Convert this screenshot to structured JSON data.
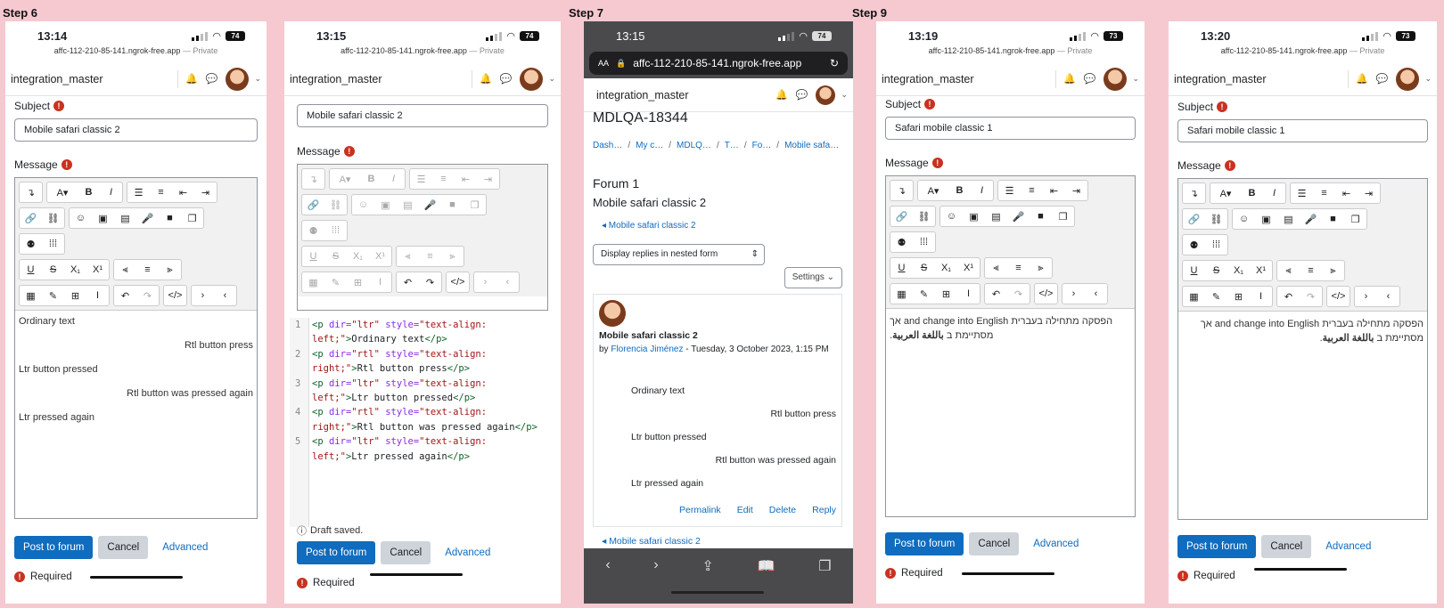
{
  "steps": [
    "Step 6",
    "Step 7",
    "Step 9"
  ],
  "status": {
    "times": [
      "13:14",
      "13:15",
      "13:15",
      "13:19",
      "13:20"
    ],
    "batteries": [
      "74",
      "74",
      "74",
      "73",
      "73"
    ],
    "url": "affc-112-210-85-141.ngrok-free.app",
    "private": "— Private",
    "safari_url": "affc-112-210-85-141.ngrok-free.app",
    "aa": "AA"
  },
  "nav": {
    "username": "integration_master"
  },
  "form": {
    "subject_label": "Subject",
    "message_label": "Message",
    "subject_p1": "Mobile safari classic 2",
    "subject_p2": "Mobile safari classic 2",
    "subject_p4": "Safari mobile classic 1",
    "subject_p5": "Safari mobile classic 1",
    "post_label": "Post to forum",
    "cancel_label": "Cancel",
    "advanced_label": "Advanced",
    "required_label": "Required",
    "draft_saved": "Draft saved."
  },
  "toolbar_icons": [
    "arrow-icon",
    "font-icon",
    "bold-icon",
    "italic-icon",
    "bullets-icon",
    "numbered-icon",
    "outdent-icon",
    "indent-icon",
    "link-icon",
    "unlink-icon",
    "emoji-icon",
    "image-icon",
    "media-icon",
    "record-audio-icon",
    "record-video-icon",
    "copy-icon",
    "accessibility-icon",
    "equation-grid-icon",
    "underline-icon",
    "strike-icon",
    "subscript-icon",
    "superscript-icon",
    "align-left-icon",
    "align-center-icon",
    "align-right-icon",
    "calculator-icon",
    "edit-icon",
    "table-icon",
    "clear-format-icon",
    "undo-icon",
    "redo-icon",
    "html-icon",
    "ltr-icon",
    "rtl-icon"
  ],
  "content_lines": [
    "Ordinary text",
    "Rtl button press",
    "Ltr button pressed",
    "Rtl button was pressed again",
    "Ltr pressed again"
  ],
  "html_code": [
    {
      "num": "1",
      "dir": "ltr",
      "align": "left",
      "text": "Ordinary text"
    },
    {
      "num": "2",
      "dir": "rtl",
      "align": "right",
      "text": "Rtl button press"
    },
    {
      "num": "3",
      "dir": "ltr",
      "align": "left",
      "text": "Ltr button pressed"
    },
    {
      "num": "4",
      "dir": "rtl",
      "align": "right",
      "text": "Rtl button was pressed again"
    },
    {
      "num": "5",
      "dir": "ltr",
      "align": "left",
      "text": "Ltr pressed again"
    }
  ],
  "forum": {
    "course": "MDLQA-18344",
    "breadcrumbs": [
      "Dash…",
      "My c…",
      "MDLQ…",
      "T…",
      "Fo…",
      "Mobile safa…"
    ],
    "forum_title": "Forum 1",
    "discussion_title": "Mobile safari classic 2",
    "back_link": "◂ Mobile safari classic 2",
    "display_mode": "Display replies in nested form",
    "settings": "Settings",
    "post_subject": "Mobile safari classic 2",
    "post_by": "by",
    "post_author": "Florencia Jiménez",
    "post_date": " - Tuesday, 3 October 2023, 1:15 PM",
    "actions": [
      "Permalink",
      "Edit",
      "Delete",
      "Reply"
    ],
    "footer_link": "◂ Mobile safari classic 2"
  },
  "mixed_text": {
    "line1": "הפסקה מתחילה בעברית and change into English אך",
    "line2_pre": "מסתיימת ב ",
    "line2_bold": "باللغة العربية",
    "line2_post": "."
  },
  "colors": {
    "primary": "#0f6cbf",
    "required": "#ca3120",
    "background": "#f6c9d1"
  }
}
